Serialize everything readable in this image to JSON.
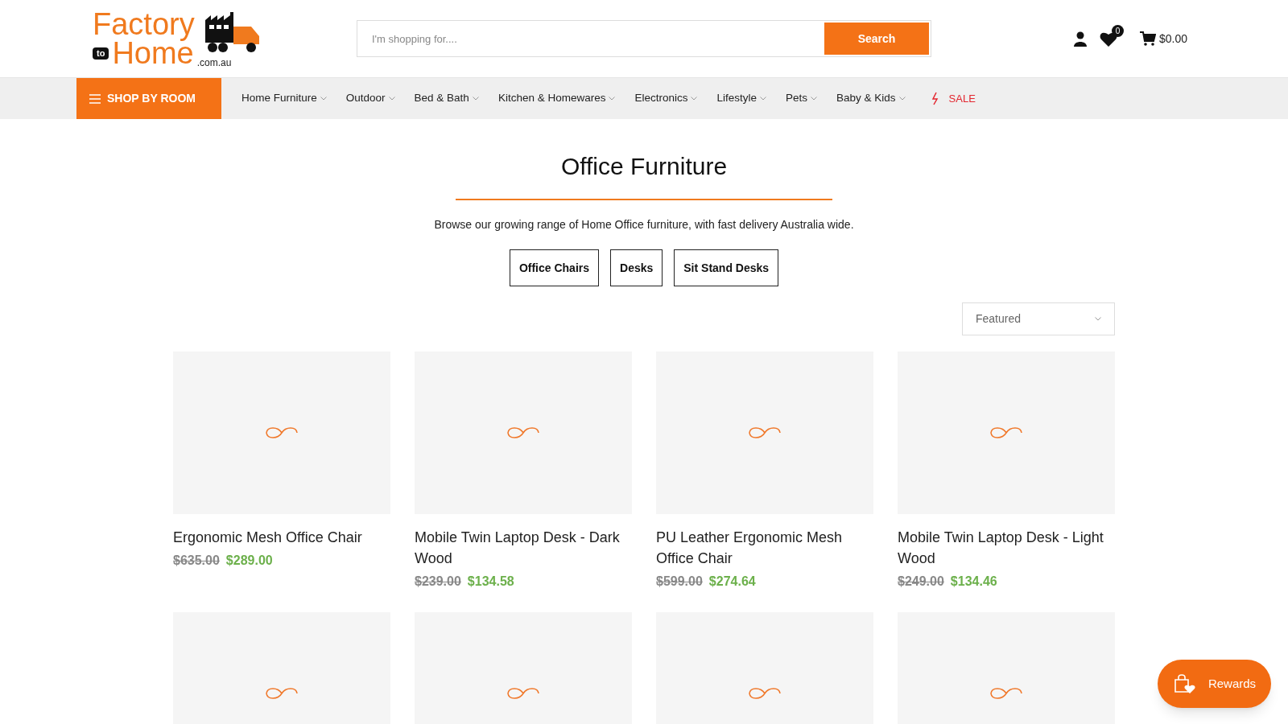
{
  "logo": {
    "line_1": "Factory",
    "badge": "to",
    "line_2": "Home",
    "domain": ".com.au"
  },
  "search": {
    "placeholder": "I'm shopping for....",
    "button": "Search"
  },
  "header_icons": {
    "wishlist_count": "0",
    "cart_total": "$0.00"
  },
  "nav": {
    "shop_by_room": "SHOP BY ROOM",
    "items": [
      {
        "label": "Home Furniture",
        "kind": "menu"
      },
      {
        "label": "Outdoor",
        "kind": "menu"
      },
      {
        "label": "Bed & Bath",
        "kind": "menu"
      },
      {
        "label": "Kitchen & Homewares",
        "kind": "menu"
      },
      {
        "label": "Electronics",
        "kind": "menu"
      },
      {
        "label": "Lifestyle",
        "kind": "menu"
      },
      {
        "label": "Pets",
        "kind": "menu"
      },
      {
        "label": "Baby & Kids",
        "kind": "menu"
      },
      {
        "label": "SALE",
        "kind": "sale"
      }
    ]
  },
  "page": {
    "title": "Office Furniture",
    "description": "Browse our growing range of Home Office furniture, with fast delivery Australia wide.",
    "subcategories": [
      "Office Chairs",
      "Desks",
      "Sit Stand Desks"
    ]
  },
  "sort": {
    "value": "Featured"
  },
  "products": [
    {
      "kind": "card",
      "name": "Ergonomic Mesh Office Chair",
      "old_price": "$635.00",
      "price": "$289.00"
    },
    {
      "kind": "card",
      "name": "Mobile Twin Laptop Desk - Dark Wood",
      "old_price": "$239.00",
      "price": "$134.58"
    },
    {
      "kind": "card",
      "name": "PU Leather Ergonomic Mesh Office Chair",
      "old_price": "$599.00",
      "price": "$274.64"
    },
    {
      "kind": "card",
      "name": "Mobile Twin Laptop Desk - Light Wood",
      "old_price": "$249.00",
      "price": "$134.46"
    },
    {
      "kind": "image-only"
    },
    {
      "kind": "image-only"
    },
    {
      "kind": "image-only"
    },
    {
      "kind": "image-only"
    }
  ],
  "rewards": {
    "label": "Rewards"
  }
}
